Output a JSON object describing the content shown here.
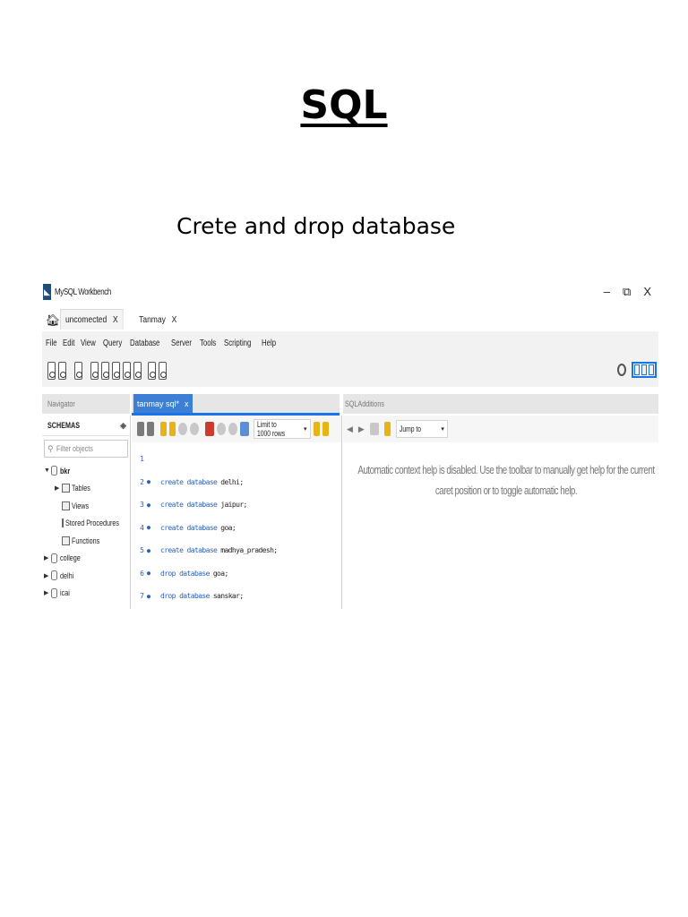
{
  "document": {
    "title": "SQL",
    "subtitle": "Crete and drop database"
  },
  "workbench": {
    "app_title": "MySQL Workbench",
    "window_controls": {
      "minimize": "–",
      "restore": "⧉",
      "close": "X"
    },
    "tabs": [
      {
        "label": "uncomected",
        "close": "X"
      },
      {
        "label": "Tanmay",
        "close": "X"
      }
    ],
    "menu": [
      "File",
      "Edit",
      "View",
      "Query",
      "Database",
      "Server",
      "Tools",
      "Scripting",
      "Help"
    ],
    "navigator": {
      "header": "Navigator",
      "schemas_label": "SCHEMAS",
      "filter_placeholder": "Filter objects",
      "tree": [
        {
          "label": "bkr",
          "level": 0,
          "expanded": true,
          "type": "db"
        },
        {
          "label": "Tables",
          "level": 1,
          "expanded": false,
          "type": "folder"
        },
        {
          "label": "Views",
          "level": 1,
          "expanded": false,
          "type": "folder"
        },
        {
          "label": "Stored Procedures",
          "level": 1,
          "expanded": false,
          "type": "folder"
        },
        {
          "label": "Functions",
          "level": 1,
          "expanded": false,
          "type": "folder"
        },
        {
          "label": "college",
          "level": 0,
          "expanded": false,
          "type": "db"
        },
        {
          "label": "delhi",
          "level": 0,
          "expanded": false,
          "type": "db"
        },
        {
          "label": "icai",
          "level": 0,
          "expanded": false,
          "type": "db"
        }
      ]
    },
    "editor": {
      "tab_label": "tanmay sql*",
      "tab_close": "x",
      "limit_select": "Limit to 1000 rows",
      "lines": [
        {
          "num": "1",
          "keyword": "",
          "identifier": ""
        },
        {
          "num": "2",
          "keyword": "create database",
          "identifier": "delhi;"
        },
        {
          "num": "3",
          "keyword": "create database",
          "identifier": "jaipur;"
        },
        {
          "num": "4",
          "keyword": "create database",
          "identifier": "goa;"
        },
        {
          "num": "5",
          "keyword": "create database",
          "identifier": "madhya_pradesh;"
        },
        {
          "num": "6",
          "keyword": "drop database",
          "identifier": "goa;"
        },
        {
          "num": "7",
          "keyword": "drop database",
          "identifier": "sanskar;"
        }
      ]
    },
    "sql_additions": {
      "header": "SQLAdditions",
      "jump_to": "Jump to",
      "help_text": "Automatic context help is disabled. Use the toolbar to manually get help for the current caret position or to toggle automatic help."
    }
  }
}
